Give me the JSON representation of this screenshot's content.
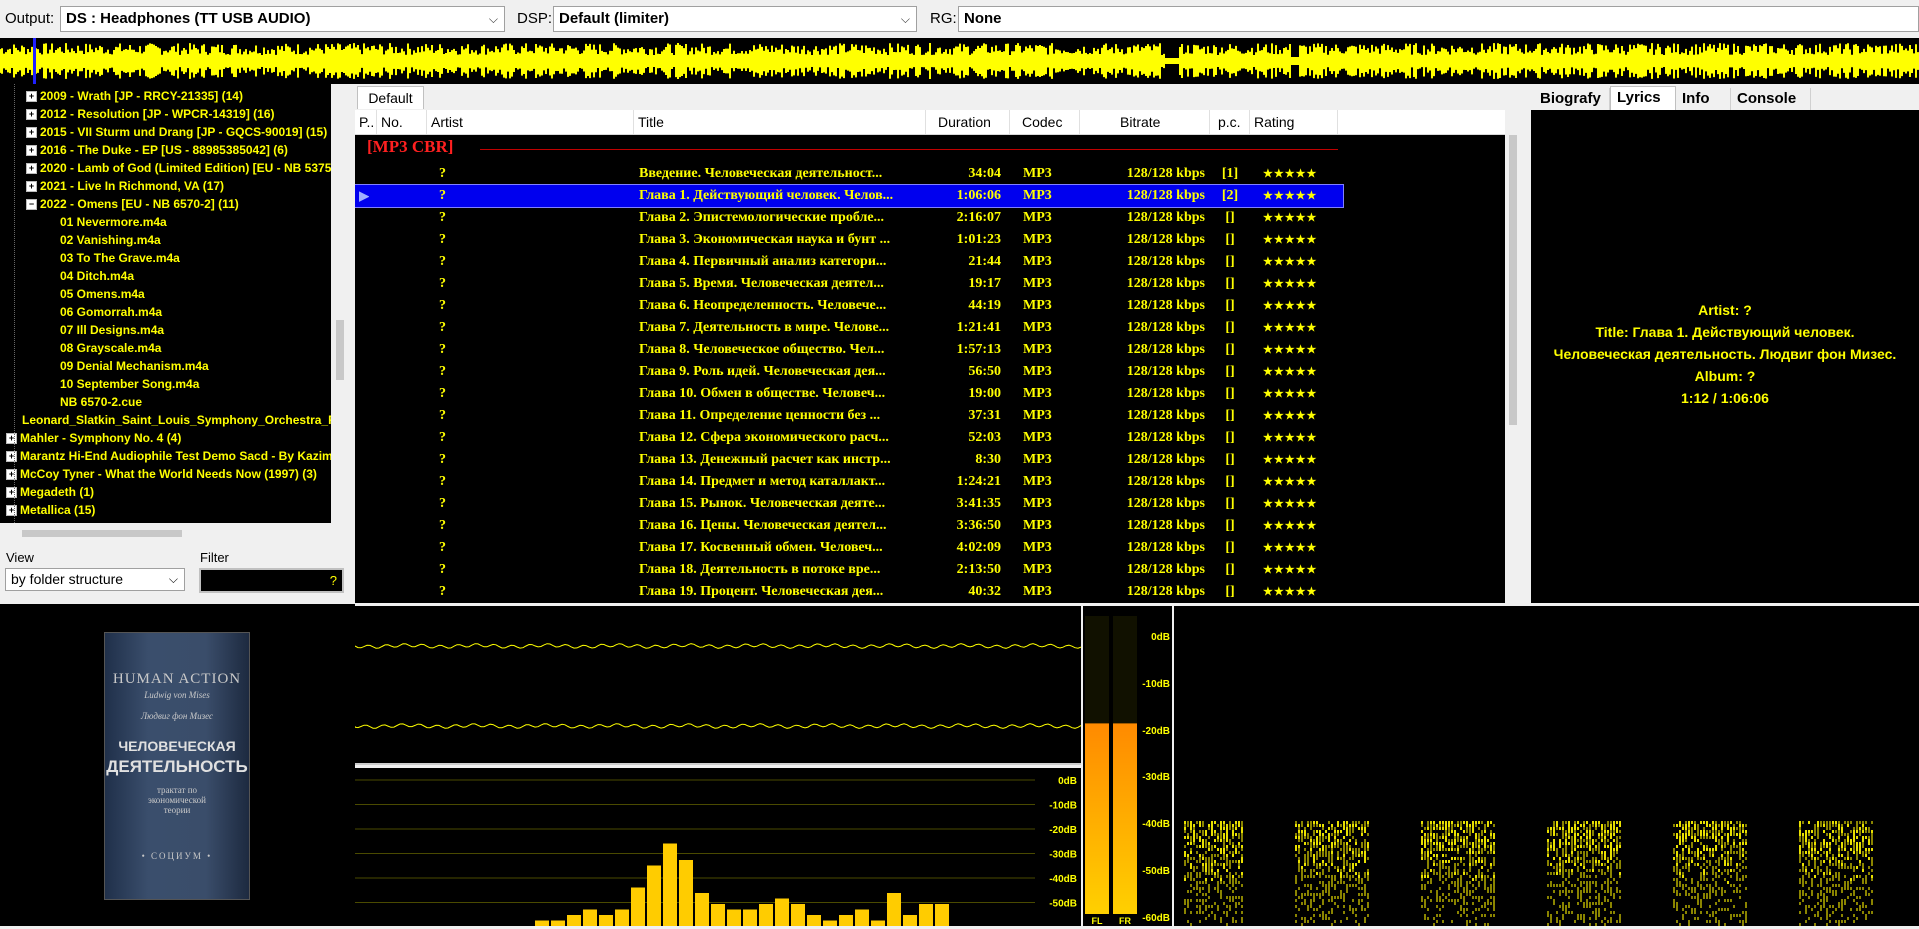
{
  "toolbar": {
    "output_label": "Output:",
    "output_value": "DS : Headphones (TT USB AUDIO)",
    "dsp_label": "DSP:",
    "dsp_value": "Default (limiter)",
    "rg_label": "RG:",
    "rg_value": "None"
  },
  "tree": {
    "items": [
      {
        "label": "2009 - Wrath [JP - RRCY-21335] (14)",
        "expander": "+"
      },
      {
        "label": "2012 - Resolution [JP - WPCR-14319] (16)",
        "expander": "+"
      },
      {
        "label": "2015 - VII Sturm und Drang [JP - GQCS-90019] (15)",
        "expander": "+"
      },
      {
        "label": "2016 - The Duke - EP [US - 88985385042] (6)",
        "expander": "+"
      },
      {
        "label": "2020 - Lamb of God (Limited Edition) [EU - NB 5375-",
        "expander": "+"
      },
      {
        "label": "2021 - Live In Richmond, VA (17)",
        "expander": "+"
      },
      {
        "label": "2022 - Omens [EU - NB 6570-2] (11)",
        "expander": "−"
      },
      {
        "label": "01 Nevermore.m4a",
        "expander": ""
      },
      {
        "label": "02 Vanishing.m4a",
        "expander": ""
      },
      {
        "label": "03 To The Grave.m4a",
        "expander": ""
      },
      {
        "label": "04 Ditch.m4a",
        "expander": ""
      },
      {
        "label": "05 Omens.m4a",
        "expander": ""
      },
      {
        "label": "06 Gomorrah.m4a",
        "expander": ""
      },
      {
        "label": "07 Ill Designs.m4a",
        "expander": ""
      },
      {
        "label": "08 Grayscale.m4a",
        "expander": ""
      },
      {
        "label": "09 Denial Mechanism.m4a",
        "expander": ""
      },
      {
        "label": "10 September Song.m4a",
        "expander": ""
      },
      {
        "label": "NB 6570-2.cue",
        "expander": ""
      },
      {
        "label": "Leonard_Slatkin_Saint_Louis_Symphony_Orchestra_R",
        "expander": ""
      },
      {
        "label": "Mahler - Symphony No. 4 (4)",
        "expander": "+"
      },
      {
        "label": "Marantz Hi-End Audiophile Test Demo Sacd - By Kazimi",
        "expander": "+"
      },
      {
        "label": "McCoy Tyner - What the World Needs Now (1997) (3)",
        "expander": "+"
      },
      {
        "label": "Megadeth (1)",
        "expander": "+"
      },
      {
        "label": "Metallica (15)",
        "expander": "+"
      }
    ]
  },
  "view": {
    "label": "View",
    "value": "by folder structure",
    "filter_label": "Filter",
    "filter_button": "?"
  },
  "album_art": {
    "title": "HUMAN ACTION",
    "subtitle": "Ludwig von Mises",
    "author": "Людвиг фон Мизес",
    "ru_title_1": "ЧЕЛОВЕЧЕСКАЯ",
    "ru_title_2": "ДЕЯТЕЛЬНОСТЬ",
    "ru_sub": "трактат по экономической теории",
    "publisher": "• СОЦИУМ •"
  },
  "playlist": {
    "tab": "Default",
    "columns": [
      "P..",
      "No.",
      "Artist",
      "Title",
      "Duration",
      "Codec",
      "Bitrate",
      "p.c.",
      "Rating"
    ],
    "group": "[MP3 CBR]",
    "rows": [
      {
        "no": "",
        "artist": "?",
        "title": "Введение. Человеческая деятельност...",
        "duration": "34:04",
        "codec": "MP3",
        "bitrate": "128/128 kbps",
        "pc": "[1]",
        "rating": "★★★★★",
        "playing": false
      },
      {
        "no": "",
        "artist": "?",
        "title": "Глава 1. Действующий человек. Челов...",
        "duration": "1:06:06",
        "codec": "MP3",
        "bitrate": "128/128 kbps",
        "pc": "[2]",
        "rating": "★★★★★",
        "playing": true
      },
      {
        "no": "",
        "artist": "?",
        "title": "Глава 2. Эпистемологические пробле...",
        "duration": "2:16:07",
        "codec": "MP3",
        "bitrate": "128/128 kbps",
        "pc": "[]",
        "rating": "★★★★★",
        "playing": false
      },
      {
        "no": "",
        "artist": "?",
        "title": "Глава 3. Экономическая наука и бунт ...",
        "duration": "1:01:23",
        "codec": "MP3",
        "bitrate": "128/128 kbps",
        "pc": "[]",
        "rating": "★★★★★",
        "playing": false
      },
      {
        "no": "",
        "artist": "?",
        "title": "Глава 4. Первичный анализ категори...",
        "duration": "21:44",
        "codec": "MP3",
        "bitrate": "128/128 kbps",
        "pc": "[]",
        "rating": "★★★★★",
        "playing": false
      },
      {
        "no": "",
        "artist": "?",
        "title": "Глава 5. Время. Человеческая деятел...",
        "duration": "19:17",
        "codec": "MP3",
        "bitrate": "128/128 kbps",
        "pc": "[]",
        "rating": "★★★★★",
        "playing": false
      },
      {
        "no": "",
        "artist": "?",
        "title": "Глава 6. Неопределенность. Человече...",
        "duration": "44:19",
        "codec": "MP3",
        "bitrate": "128/128 kbps",
        "pc": "[]",
        "rating": "★★★★★",
        "playing": false
      },
      {
        "no": "",
        "artist": "?",
        "title": "Глава 7. Деятельность в мире. Челове...",
        "duration": "1:21:41",
        "codec": "MP3",
        "bitrate": "128/128 kbps",
        "pc": "[]",
        "rating": "★★★★★",
        "playing": false
      },
      {
        "no": "",
        "artist": "?",
        "title": "Глава 8. Человеческое общество. Чел...",
        "duration": "1:57:13",
        "codec": "MP3",
        "bitrate": "128/128 kbps",
        "pc": "[]",
        "rating": "★★★★★",
        "playing": false
      },
      {
        "no": "",
        "artist": "?",
        "title": "Глава 9. Роль идей. Человеческая дея...",
        "duration": "56:50",
        "codec": "MP3",
        "bitrate": "128/128 kbps",
        "pc": "[]",
        "rating": "★★★★★",
        "playing": false
      },
      {
        "no": "",
        "artist": "?",
        "title": "Глава 10. Обмен в обществе. Человеч...",
        "duration": "19:00",
        "codec": "MP3",
        "bitrate": "128/128 kbps",
        "pc": "[]",
        "rating": "★★★★★",
        "playing": false
      },
      {
        "no": "",
        "artist": "?",
        "title": "Глава 11. Определение ценности без ...",
        "duration": "37:31",
        "codec": "MP3",
        "bitrate": "128/128 kbps",
        "pc": "[]",
        "rating": "★★★★★",
        "playing": false
      },
      {
        "no": "",
        "artist": "?",
        "title": "Глава 12. Сфера экономического расч...",
        "duration": "52:03",
        "codec": "MP3",
        "bitrate": "128/128 kbps",
        "pc": "[]",
        "rating": "★★★★★",
        "playing": false
      },
      {
        "no": "",
        "artist": "?",
        "title": "Глава 13. Денежный расчет как инстр...",
        "duration": "8:30",
        "codec": "MP3",
        "bitrate": "128/128 kbps",
        "pc": "[]",
        "rating": "★★★★★",
        "playing": false
      },
      {
        "no": "",
        "artist": "?",
        "title": "Глава 14. Предмет и метод каталлакт...",
        "duration": "1:24:21",
        "codec": "MP3",
        "bitrate": "128/128 kbps",
        "pc": "[]",
        "rating": "★★★★★",
        "playing": false
      },
      {
        "no": "",
        "artist": "?",
        "title": "Глава 15. Рынок. Человеческая деяте...",
        "duration": "3:41:35",
        "codec": "MP3",
        "bitrate": "128/128 kbps",
        "pc": "[]",
        "rating": "★★★★★",
        "playing": false
      },
      {
        "no": "",
        "artist": "?",
        "title": "Глава 16. Цены. Человеческая деятел...",
        "duration": "3:36:50",
        "codec": "MP3",
        "bitrate": "128/128 kbps",
        "pc": "[]",
        "rating": "★★★★★",
        "playing": false
      },
      {
        "no": "",
        "artist": "?",
        "title": "Глава 17. Косвенный обмен. Человеч...",
        "duration": "4:02:09",
        "codec": "MP3",
        "bitrate": "128/128 kbps",
        "pc": "[]",
        "rating": "★★★★★",
        "playing": false
      },
      {
        "no": "",
        "artist": "?",
        "title": "Глава 18. Деятельность в потоке вре...",
        "duration": "2:13:50",
        "codec": "MP3",
        "bitrate": "128/128 kbps",
        "pc": "[]",
        "rating": "★★★★★",
        "playing": false
      },
      {
        "no": "",
        "artist": "?",
        "title": "Глава 19. Процент. Человеческая дея...",
        "duration": "40:32",
        "codec": "MP3",
        "bitrate": "128/128 kbps",
        "pc": "[]",
        "rating": "★★★★★",
        "playing": false
      }
    ]
  },
  "info_panel": {
    "tabs": [
      "Biografy",
      "Lyrics",
      "Info",
      "Console"
    ],
    "active_tab": "Lyrics",
    "artist": "Artist: ?",
    "title_1": "Title: Глава 1. Действующий человек.",
    "title_2": "Человеческая деятельность. Людвиг фон Мизес.",
    "album": "Album: ?",
    "time": "1:12 / 1:06:06"
  },
  "spectrum": {
    "db_labels": [
      "0dB",
      "-10dB",
      "-20dB",
      "-30dB",
      "-40dB",
      "-50dB"
    ],
    "bar_levels": [
      0.05,
      0.05,
      0.1,
      0.15,
      0.1,
      0.15,
      0.35,
      0.55,
      0.75,
      0.6,
      0.3,
      0.2,
      0.15,
      0.15,
      0.2,
      0.25,
      0.2,
      0.1,
      0.05,
      0.1,
      0.15,
      0.05,
      0.3,
      0.1,
      0.2,
      0.2
    ]
  },
  "vu_meter": {
    "db_labels": [
      "0dB",
      "-10dB",
      "-20dB",
      "-30dB",
      "-40dB",
      "-50dB",
      "-60dB"
    ],
    "channels": [
      "FL",
      "FR"
    ],
    "levels": [
      0.82,
      0.82
    ]
  },
  "colors": {
    "text_yellow": "#ffff00",
    "group_red": "#ff2020",
    "selection_blue": "#0000ee",
    "vu_orange": "#ff9a00"
  }
}
